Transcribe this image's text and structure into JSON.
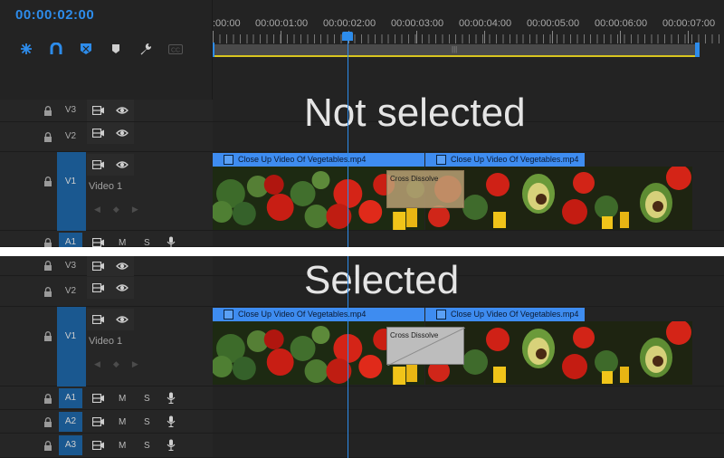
{
  "timeline": {
    "timecode": "00:00:02:00",
    "ruler_labels": [
      ":00:00",
      "00:00:01:00",
      "00:00:02:00",
      "00:00:03:00",
      "00:00:04:00",
      "00:00:05:00",
      "00:00:06:00",
      "00:00:07:00"
    ],
    "tools": [
      "snap-icon",
      "magnet-link-icon",
      "add-marker-icon",
      "marker-icon",
      "wrench-icon",
      "captions-icon"
    ]
  },
  "top_panel": {
    "label": "Not selected",
    "tracks": {
      "v3": "V3",
      "v2": "V2",
      "v1": "V1",
      "a1": "A1"
    },
    "video_label": "Video 1",
    "clip1": "Close Up Video Of Vegetables.mp4",
    "clip2": "Close Up Video Of Vegetables.mp4",
    "transition": "Cross Dissolve",
    "a1_mute": "M",
    "a1_solo": "S"
  },
  "bottom_panel": {
    "label": "Selected",
    "tracks": {
      "v3": "V3",
      "v2": "V2",
      "v1": "V1",
      "a1": "A1",
      "a2": "A2",
      "a3": "A3"
    },
    "video_label": "Video 1",
    "clip1": "Close Up Video Of Vegetables.mp4",
    "clip2": "Close Up Video Of Vegetables.mp4",
    "transition": "Cross Dissolve",
    "mute": "M",
    "solo": "S"
  },
  "colors": {
    "accent": "#2d8ceb",
    "clip_header": "#3e8cf0",
    "track_target": "#1a5890",
    "work_area": "#d9c51f"
  }
}
